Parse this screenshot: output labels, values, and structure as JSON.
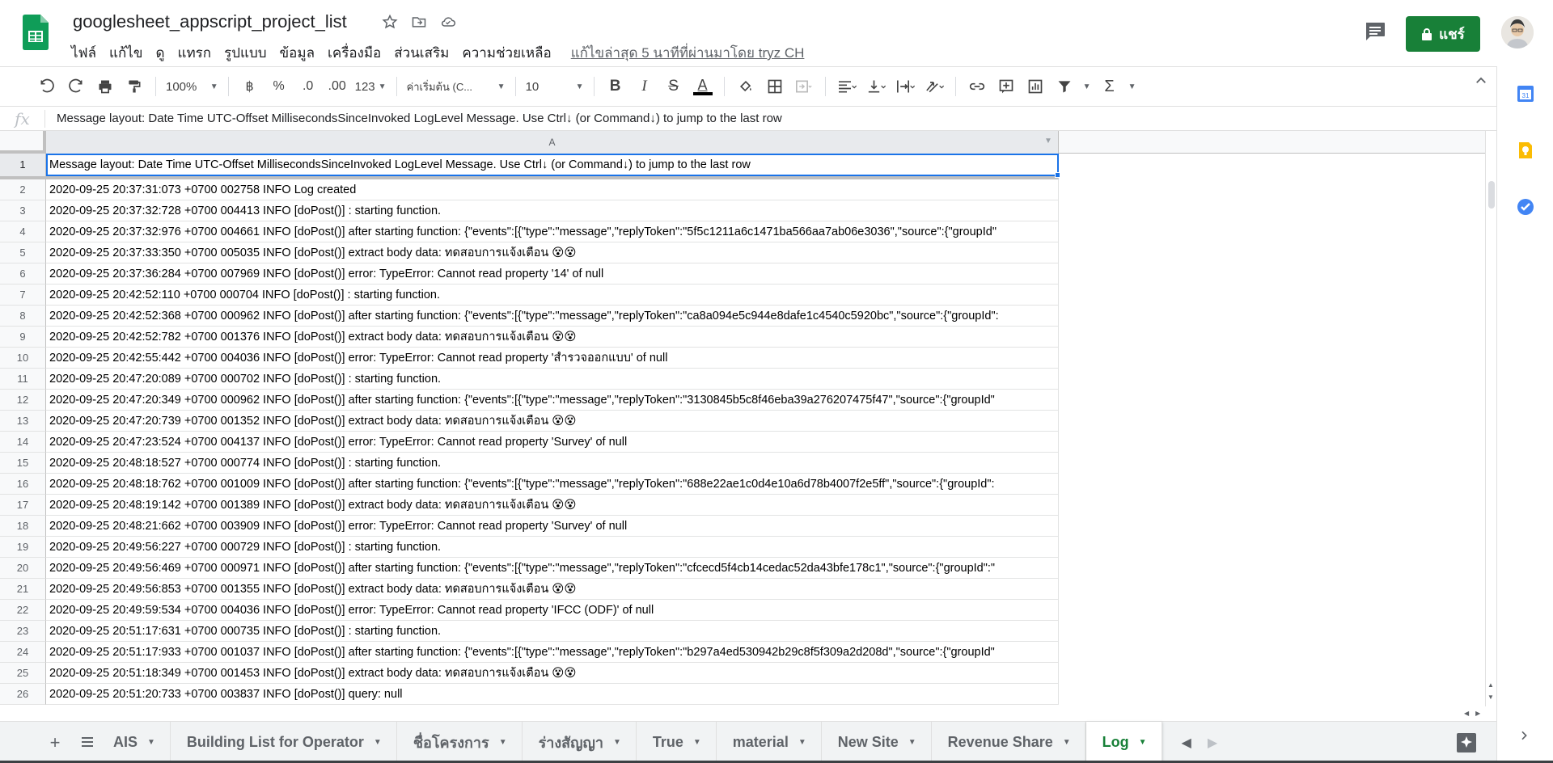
{
  "header": {
    "doc_title": "googlesheet_appscript_project_list",
    "menu": [
      "ไฟล์",
      "แก้ไข",
      "ดู",
      "แทรก",
      "รูปแบบ",
      "ข้อมูล",
      "เครื่องมือ",
      "ส่วนเสริม",
      "ความช่วยเหลือ"
    ],
    "last_edit": "แก้ไขล่าสุด 5 นาทีที่ผ่านมาโดย tryz CH",
    "share_label": "แชร์",
    "share_color": "#188038"
  },
  "toolbar": {
    "zoom": "100%",
    "currency": "฿",
    "percent": "%",
    "decrease_decimal": ".0",
    "increase_decimal": ".00",
    "more_formats": "123",
    "font": "ค่าเริ่มต้น (C...",
    "font_size": "10",
    "bold": "B",
    "italic": "I",
    "strike": "S",
    "text_color": "A"
  },
  "formula_bar": {
    "fx": "fx",
    "content": "Message layout: Date Time UTC-Offset MillisecondsSinceInvoked LogLevel Message. Use Ctrl↓ (or Command↓) to jump to the last row"
  },
  "grid": {
    "column": "A",
    "rows": [
      {
        "n": "1",
        "text": "Message layout: Date Time UTC-Offset MillisecondsSinceInvoked LogLevel Message. Use Ctrl↓ (or Command↓) to jump to the last row"
      },
      {
        "n": "2",
        "text": "2020-09-25 20:37:31:073 +0700 002758 INFO Log created"
      },
      {
        "n": "3",
        "text": "2020-09-25 20:37:32:728 +0700 004413 INFO [doPost()] : starting function."
      },
      {
        "n": "4",
        "text": "2020-09-25 20:37:32:976 +0700 004661 INFO [doPost()] after starting function: {\"events\":[{\"type\":\"message\",\"replyToken\":\"5f5c1211a6c1471ba566aa7ab06e3036\",\"source\":{\"groupId\""
      },
      {
        "n": "5",
        "text": "2020-09-25 20:37:33:350 +0700 005035 INFO [doPost()] extract body data: ทดสอบการแจ้งเตือน 😵😵"
      },
      {
        "n": "6",
        "text": "2020-09-25 20:37:36:284 +0700 007969 INFO [doPost()] error: TypeError: Cannot read property '14' of null"
      },
      {
        "n": "7",
        "text": "2020-09-25 20:42:52:110 +0700 000704 INFO [doPost()] : starting function."
      },
      {
        "n": "8",
        "text": "2020-09-25 20:42:52:368 +0700 000962 INFO [doPost()] after starting function: {\"events\":[{\"type\":\"message\",\"replyToken\":\"ca8a094e5c944e8dafe1c4540c5920bc\",\"source\":{\"groupId\":"
      },
      {
        "n": "9",
        "text": "2020-09-25 20:42:52:782 +0700 001376 INFO [doPost()] extract body data: ทดสอบการแจ้งเตือน 😵😵"
      },
      {
        "n": "10",
        "text": "2020-09-25 20:42:55:442 +0700 004036 INFO [doPost()] error: TypeError: Cannot read property 'สำรวจออกแบบ' of null"
      },
      {
        "n": "11",
        "text": "2020-09-25 20:47:20:089 +0700 000702 INFO [doPost()] : starting function."
      },
      {
        "n": "12",
        "text": "2020-09-25 20:47:20:349 +0700 000962 INFO [doPost()] after starting function: {\"events\":[{\"type\":\"message\",\"replyToken\":\"3130845b5c8f46eba39a276207475f47\",\"source\":{\"groupId\""
      },
      {
        "n": "13",
        "text": "2020-09-25 20:47:20:739 +0700 001352 INFO [doPost()] extract body data: ทดสอบการแจ้งเตือน 😵😵"
      },
      {
        "n": "14",
        "text": "2020-09-25 20:47:23:524 +0700 004137 INFO [doPost()] error: TypeError: Cannot read property 'Survey' of null"
      },
      {
        "n": "15",
        "text": "2020-09-25 20:48:18:527 +0700 000774 INFO [doPost()] : starting function."
      },
      {
        "n": "16",
        "text": "2020-09-25 20:48:18:762 +0700 001009 INFO [doPost()] after starting function: {\"events\":[{\"type\":\"message\",\"replyToken\":\"688e22ae1c0d4e10a6d78b4007f2e5ff\",\"source\":{\"groupId\":"
      },
      {
        "n": "17",
        "text": "2020-09-25 20:48:19:142 +0700 001389 INFO [doPost()] extract body data: ทดสอบการแจ้งเตือน 😵😵"
      },
      {
        "n": "18",
        "text": "2020-09-25 20:48:21:662 +0700 003909 INFO [doPost()] error: TypeError: Cannot read property 'Survey' of null"
      },
      {
        "n": "19",
        "text": "2020-09-25 20:49:56:227 +0700 000729 INFO [doPost()] : starting function."
      },
      {
        "n": "20",
        "text": "2020-09-25 20:49:56:469 +0700 000971 INFO [doPost()] after starting function: {\"events\":[{\"type\":\"message\",\"replyToken\":\"cfcecd5f4cb14cedac52da43bfe178c1\",\"source\":{\"groupId\":\""
      },
      {
        "n": "21",
        "text": "2020-09-25 20:49:56:853 +0700 001355 INFO [doPost()] extract body data: ทดสอบการแจ้งเตือน 😵😵"
      },
      {
        "n": "22",
        "text": "2020-09-25 20:49:59:534 +0700 004036 INFO [doPost()] error: TypeError: Cannot read property 'IFCC (ODF)' of null"
      },
      {
        "n": "23",
        "text": "2020-09-25 20:51:17:631 +0700 000735 INFO [doPost()] : starting function."
      },
      {
        "n": "24",
        "text": "2020-09-25 20:51:17:933 +0700 001037 INFO [doPost()] after starting function: {\"events\":[{\"type\":\"message\",\"replyToken\":\"b297a4ed530942b29c8f5f309a2d208d\",\"source\":{\"groupId\""
      },
      {
        "n": "25",
        "text": "2020-09-25 20:51:18:349 +0700 001453 INFO [doPost()] extract body data: ทดสอบการแจ้งเตือน 😵😵"
      },
      {
        "n": "26",
        "text": "2020-09-25 20:51:20:733 +0700 003837 INFO [doPost()] query: null"
      }
    ]
  },
  "sheets": {
    "tabs": [
      "AIS",
      "Building List for Operator",
      "ชื่อโครงการ",
      "ร่างสัญญา",
      "True",
      "material",
      "New Site",
      "Revenue Share",
      "Log"
    ],
    "active": "Log",
    "active_color": "#188038"
  },
  "icons": {
    "star": "star-icon",
    "move": "move-to-folder-icon",
    "cloud": "cloud-status-icon",
    "lock": "lock-icon",
    "comment": "comment-icon"
  }
}
